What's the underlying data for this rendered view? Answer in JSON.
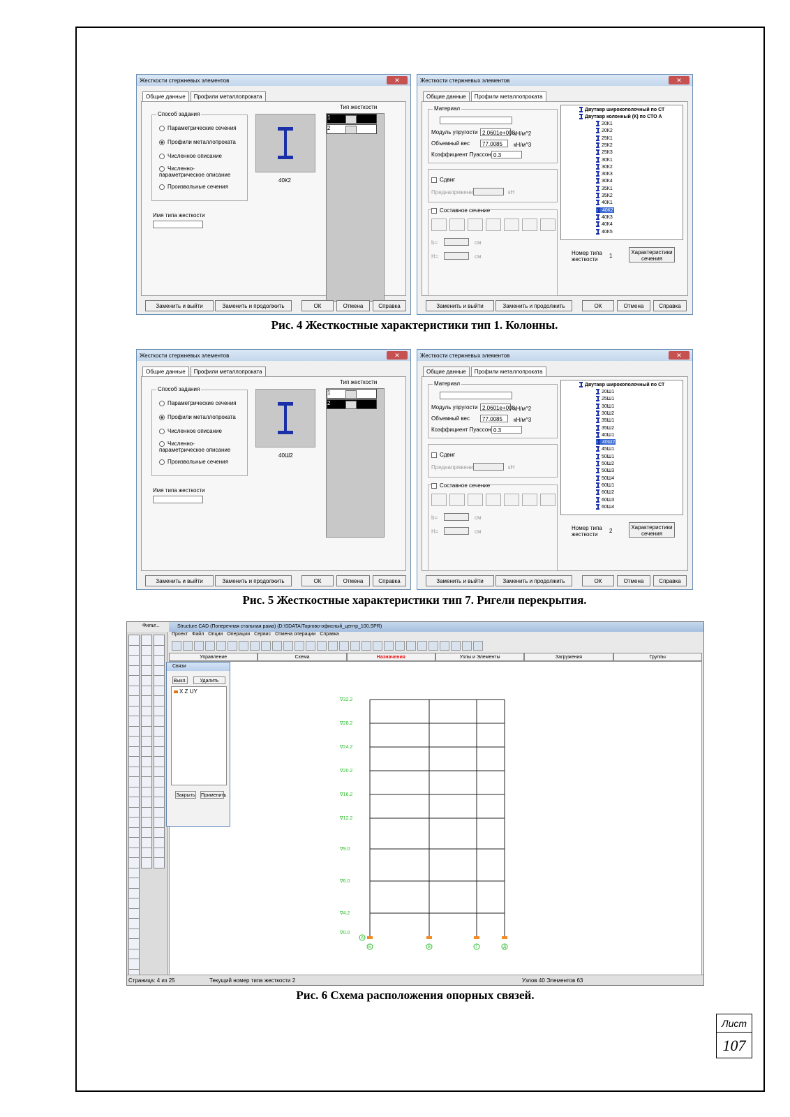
{
  "fig4": {
    "caption": "Рис. 4 Жесткостные характеристики тип 1. Колонны.",
    "left": {
      "title": "Жесткости стержневых элементов",
      "tab1": "Общие данные",
      "tab2": "Профили металлопроката",
      "group_label": "Способ задания",
      "radios": [
        "Параметрические сечения",
        "Профили металлопроката",
        "Численное описание",
        "Численно-параметрическое описание",
        "Произвольные сечения"
      ],
      "selected_radio": 1,
      "section_name": "40К2",
      "type_header": "Тип жесткости",
      "types": [
        "1",
        "2"
      ],
      "selected_type": 0,
      "stiffness_name_label": "Имя типа жесткости",
      "buttons": {
        "replace_exit": "Заменить и выйти",
        "replace_continue": "Заменить и продолжить",
        "ok": "ОК",
        "cancel": "Отмена",
        "help": "Справка"
      }
    },
    "right": {
      "title": "Жесткости стержневых элементов",
      "tab1": "Общие данные",
      "tab2": "Профили металлопроката",
      "material_label": "Материал",
      "modulus_label": "Модуль упругости",
      "modulus_value": "2.0601е+008",
      "modulus_unit": "кН/м^2",
      "weight_label": "Объемный вес",
      "weight_value": "77.0085",
      "weight_unit": "кН/м^3",
      "poisson_label": "Коэффициент Пуассона",
      "poisson_value": "0.3",
      "shift_label": "Сдвиг",
      "prestress_label": "Преднапряжение",
      "prestress_unit": "кН",
      "composite_label": "Составное сечение",
      "cm": "см",
      "b_label": "b=",
      "h_label": "H=",
      "tree_root1": "Двутавр широкополочный по СТ",
      "tree_root2": "Двутавр колонный (К) по СТО А",
      "tree_items": [
        "20К1",
        "20К2",
        "25К1",
        "25К2",
        "25К3",
        "30К1",
        "30К2",
        "30К3",
        "30К4",
        "35К1",
        "35К2",
        "40К1",
        "40К2",
        "40К3",
        "40К4",
        "40К5"
      ],
      "tree_selected": 12,
      "type_no_label": "Номер типа жесткости",
      "type_no": "1",
      "char_button": "Характеристики сечения",
      "buttons": {
        "replace_exit": "Заменить и выйти",
        "replace_continue": "Заменить и продолжить",
        "ok": "ОК",
        "cancel": "Отмена",
        "help": "Справка"
      }
    }
  },
  "fig5": {
    "caption": "Рис. 5 Жесткостные характеристики тип 7. Ригели перекрытия.",
    "left": {
      "title": "Жесткости стержневых элементов",
      "tab1": "Общие данные",
      "tab2": "Профили металлопроката",
      "group_label": "Способ задания",
      "radios": [
        "Параметрические сечения",
        "Профили металлопроката",
        "Численное описание",
        "Численно-параметрическое описание",
        "Произвольные сечения"
      ],
      "selected_radio": 1,
      "section_name": "40Ш2",
      "type_header": "Тип жесткости",
      "types": [
        "1",
        "2"
      ],
      "selected_type": 1,
      "stiffness_name_label": "Имя типа жесткости",
      "buttons": {
        "replace_exit": "Заменить и выйти",
        "replace_continue": "Заменить и продолжить",
        "ok": "ОК",
        "cancel": "Отмена",
        "help": "Справка"
      }
    },
    "right": {
      "title": "Жесткости стержневых элементов",
      "tab1": "Общие данные",
      "tab2": "Профили металлопроката",
      "material_label": "Материал",
      "modulus_label": "Модуль упругости",
      "modulus_value": "2.0601е+008",
      "modulus_unit": "кН/м^2",
      "weight_label": "Объемный вес",
      "weight_value": "77.0085",
      "weight_unit": "кН/м^3",
      "poisson_label": "Коэффициент Пуассона",
      "poisson_value": "0.3",
      "shift_label": "Сдвиг",
      "prestress_label": "Преднапряжение",
      "prestress_unit": "кН",
      "composite_label": "Составное сечение",
      "cm": "см",
      "b_label": "b=",
      "h_label": "H=",
      "tree_root1": "Двутавр широкополочный по СТ",
      "tree_items": [
        "20Ш1",
        "25Ш1",
        "30Ш1",
        "30Ш2",
        "35Ш1",
        "35Ш2",
        "40Ш1",
        "40Ш2",
        "45Ш1",
        "50Ш1",
        "50Ш2",
        "50Ш3",
        "50Ш4",
        "60Ш1",
        "60Ш2",
        "60Ш3",
        "60Ш4"
      ],
      "tree_selected": 7,
      "type_no_label": "Номер типа жесткости",
      "type_no": "2",
      "char_button": "Характеристики сечения",
      "buttons": {
        "replace_exit": "Заменить и выйти",
        "replace_continue": "Заменить и продолжить",
        "ok": "ОК",
        "cancel": "Отмена",
        "help": "Справка"
      }
    }
  },
  "fig6": {
    "caption": "Рис. 6 Схема расположения опорных связей.",
    "window_title": "Structure CAD (Поперечная стальная рама) (D:\\SDATA\\Торгово-офисный_центр_100.SPR)",
    "filter_label": "Фильт...",
    "menu": [
      "Проект",
      "Файл",
      "Опции",
      "Операции",
      "Сервис",
      "Отмена операции",
      "Справка"
    ],
    "tabs": [
      "Управление",
      "Схема",
      "Назначения",
      "Узлы и Элементы",
      "Загружения",
      "Группы"
    ],
    "active_tab": 2,
    "panel": {
      "title": "Связи",
      "off": "Выкл.",
      "remove": "Удалить связи",
      "item": "X Z UY",
      "close": "Закрыть",
      "apply": "Применить"
    },
    "levels": [
      "∇32.2",
      "∇28.2",
      "∇24.2",
      "∇20.2",
      "∇16.2",
      "∇12.2",
      "∇9.0",
      "∇6.0",
      "∇4.2",
      "∇0.0"
    ],
    "axes": [
      "А",
      "Б",
      "В",
      "Г",
      "Д"
    ],
    "status_left": "Страница: 4 из 25",
    "status_mid": "Текущий номер типа жесткости 2",
    "status_right": "Узлов 40 Элементов 63"
  },
  "sheet": {
    "label": "Лист",
    "number": "107"
  }
}
